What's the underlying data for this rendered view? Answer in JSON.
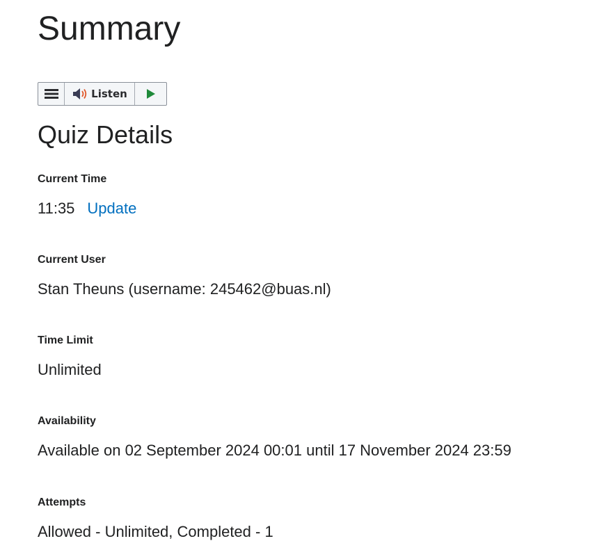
{
  "page": {
    "title": "Summary"
  },
  "listen_toolbar": {
    "menu_icon": "hamburger-menu-icon",
    "speaker_icon": "speaker-icon",
    "listen_label": "Listen",
    "play_icon": "play-icon",
    "colors": {
      "play": "#1f8a3a",
      "speaker_waves": "#e0572a"
    }
  },
  "quiz_details": {
    "heading": "Quiz Details",
    "current_time": {
      "label": "Current Time",
      "value": "11:35",
      "update_link": "Update"
    },
    "current_user": {
      "label": "Current User",
      "value": "Stan Theuns (username: 245462@buas.nl)"
    },
    "time_limit": {
      "label": "Time Limit",
      "value": "Unlimited"
    },
    "availability": {
      "label": "Availability",
      "value": "Available on 02 September 2024 00:01 until 17 November 2024 23:59"
    },
    "attempts": {
      "label": "Attempts",
      "value": "Allowed - Unlimited, Completed - 1"
    }
  },
  "colors": {
    "text": "#202122",
    "link": "#006fbf"
  }
}
